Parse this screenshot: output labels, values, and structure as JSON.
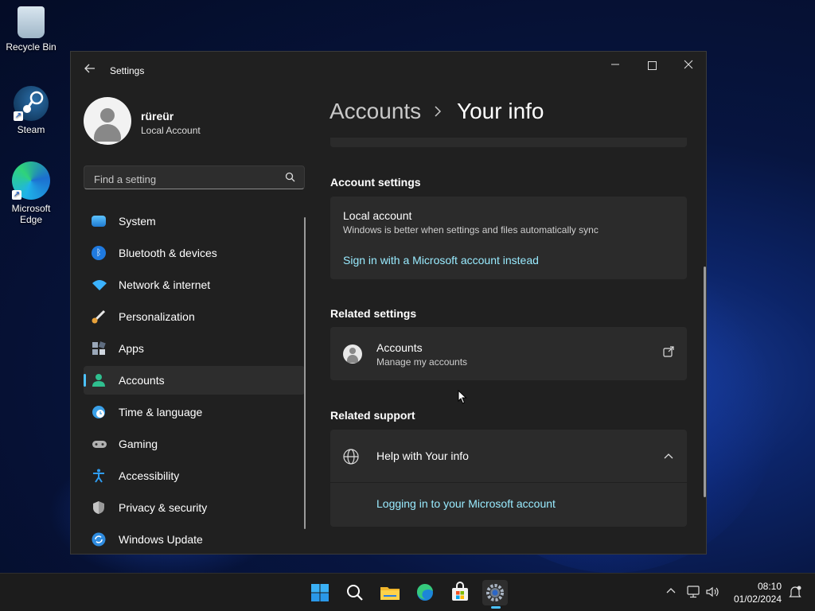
{
  "desktop": {
    "icons": [
      {
        "label": "Recycle Bin"
      },
      {
        "label": "Steam"
      },
      {
        "label": "Microsoft Edge"
      }
    ]
  },
  "window": {
    "app_title": "Settings",
    "user": {
      "name": "rüreür",
      "type": "Local Account"
    },
    "search": {
      "placeholder": "Find a setting"
    },
    "nav": [
      {
        "label": "System",
        "color": "#3aa0e8"
      },
      {
        "label": "Bluetooth & devices",
        "color": "#1f7ae0"
      },
      {
        "label": "Network & internet",
        "color": "#3bb3ff"
      },
      {
        "label": "Personalization",
        "color": "#e8a23a"
      },
      {
        "label": "Apps",
        "color": "#9aa7b8"
      },
      {
        "label": "Accounts",
        "color": "#2fbf8f"
      },
      {
        "label": "Time & language",
        "color": "#3aa0e8"
      },
      {
        "label": "Gaming",
        "color": "#b0b0b0"
      },
      {
        "label": "Accessibility",
        "color": "#2f9cf0"
      },
      {
        "label": "Privacy & security",
        "color": "#9a9a9a"
      },
      {
        "label": "Windows Update",
        "color": "#2f8ce0"
      }
    ],
    "active_nav": "Accounts",
    "breadcrumb": {
      "parent": "Accounts",
      "current": "Your info"
    },
    "account_settings": {
      "heading": "Account settings",
      "title": "Local account",
      "subtitle": "Windows is better when settings and files automatically sync",
      "link": "Sign in with a Microsoft account instead"
    },
    "related_settings": {
      "heading": "Related settings",
      "title": "Accounts",
      "subtitle": "Manage my accounts"
    },
    "related_support": {
      "heading": "Related support",
      "title": "Help with Your info",
      "link": "Logging in to your Microsoft account"
    }
  },
  "taskbar": {
    "time": "08:10",
    "date": "01/02/2024"
  },
  "colors": {
    "accent": "#4cc2ff",
    "link": "#99ebff"
  }
}
